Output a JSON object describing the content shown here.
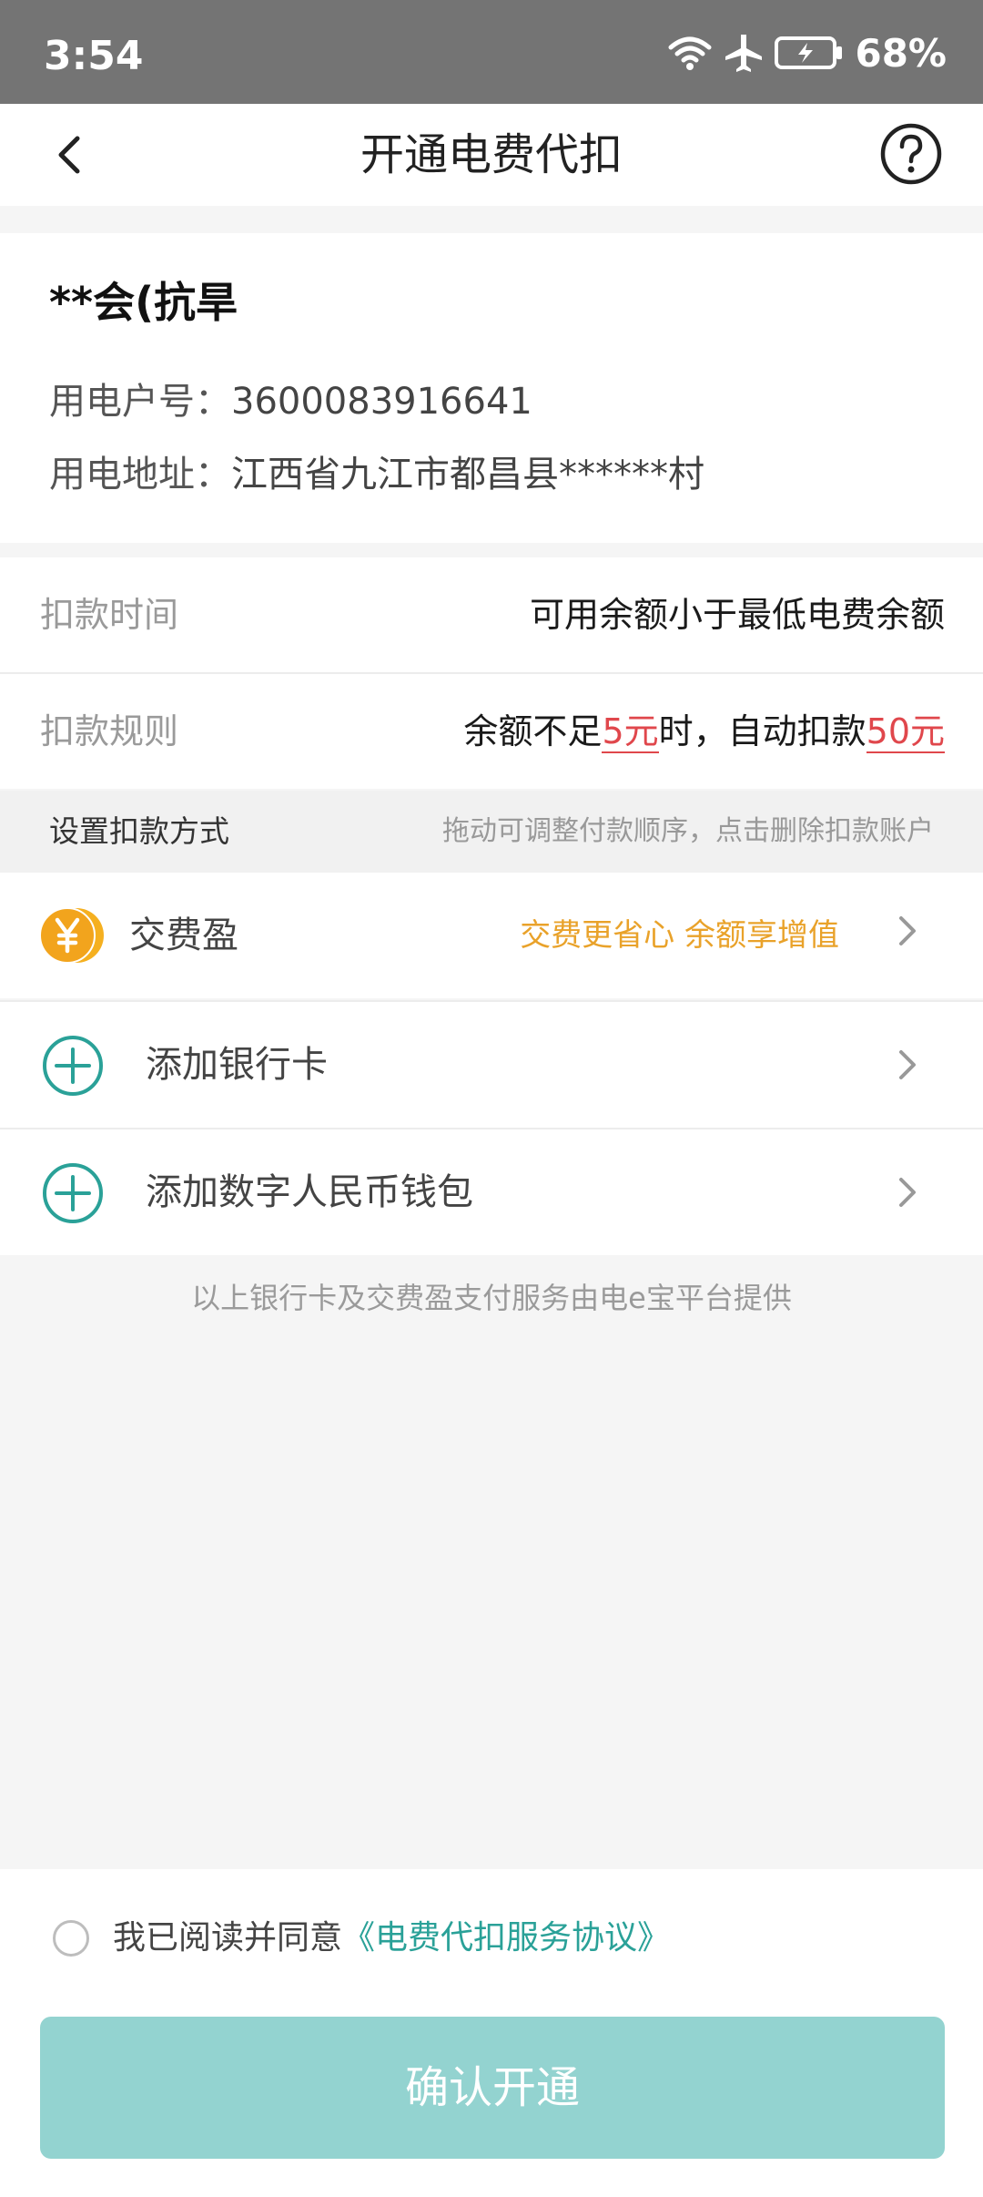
{
  "status_bar": {
    "time": "3:54",
    "battery_pct": "68%",
    "icons": [
      "wifi-icon",
      "airplane-icon",
      "battery-charging-icon"
    ]
  },
  "header": {
    "title": "开通电费代扣",
    "back_icon": "chevron-left-icon",
    "help_icon": "question-circle-icon"
  },
  "account": {
    "name": "**会(抗旱",
    "account_label": "用电户号：",
    "account_value": "3600083916641",
    "address_label": "用电地址：",
    "address_value": "江西省九江市都昌县******村"
  },
  "deduction": {
    "time_label": "扣款时间",
    "time_value": "可用余额小于最低电费余额",
    "rule_label": "扣款规则",
    "rule_prefix": "余额不足",
    "rule_threshold": "5元",
    "rule_middle": "时，自动扣款",
    "rule_amount": "50元"
  },
  "payment_section": {
    "title": "设置扣款方式",
    "hint": "拖动可调整付款顺序，点击删除扣款账户"
  },
  "payment_methods": [
    {
      "label": "交费盈",
      "promo": "交费更省心 余额享增值",
      "icon": "yen-coin-icon"
    },
    {
      "label": "添加银行卡",
      "icon": "plus-circle-icon"
    },
    {
      "label": "添加数字人民币钱包",
      "icon": "plus-circle-icon"
    }
  ],
  "footnote": "以上银行卡及交费盈支付服务由电e宝平台提供",
  "agreement": {
    "prefix": "我已阅读并同意",
    "link": "《电费代扣服务协议》",
    "checked": false
  },
  "confirm_button": "确认开通",
  "colors": {
    "accent_teal": "#2aa198",
    "button_disabled": "#93d3d0",
    "highlight_red": "#e0474c",
    "promo_orange": "#e9a22a"
  }
}
